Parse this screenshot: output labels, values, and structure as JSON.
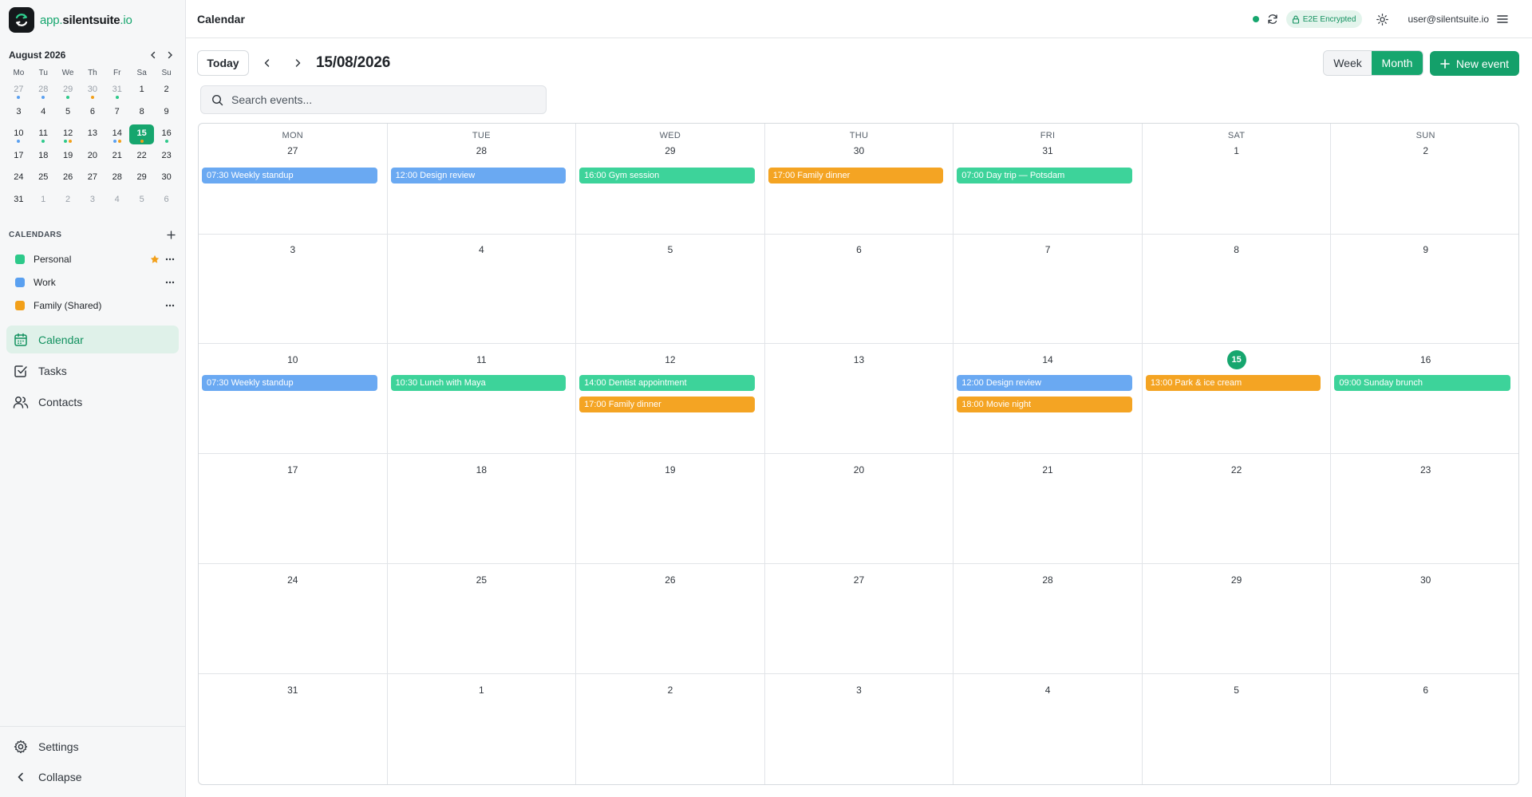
{
  "brand": {
    "app": "app.",
    "domain": "silentsuite",
    "tld": ".io"
  },
  "mini_calendar": {
    "title": "August 2026",
    "weekdays": [
      "Mo",
      "Tu",
      "We",
      "Th",
      "Fr",
      "Sa",
      "Su"
    ],
    "weeks": [
      [
        {
          "d": "27",
          "out": true,
          "dots": [
            "#5aa0f0"
          ]
        },
        {
          "d": "28",
          "out": true,
          "dots": [
            "#5aa0f0"
          ]
        },
        {
          "d": "29",
          "out": true,
          "dots": [
            "#2dc98a"
          ]
        },
        {
          "d": "30",
          "out": true,
          "dots": [
            "#f2a01a"
          ]
        },
        {
          "d": "31",
          "out": true,
          "dots": [
            "#2dc98a"
          ]
        },
        {
          "d": "1"
        },
        {
          "d": "2"
        }
      ],
      [
        {
          "d": "3"
        },
        {
          "d": "4"
        },
        {
          "d": "5"
        },
        {
          "d": "6"
        },
        {
          "d": "7"
        },
        {
          "d": "8"
        },
        {
          "d": "9"
        }
      ],
      [
        {
          "d": "10",
          "dots": [
            "#5aa0f0"
          ]
        },
        {
          "d": "11",
          "dots": [
            "#2dc98a"
          ]
        },
        {
          "d": "12",
          "dots": [
            "#2dc98a",
            "#f2a01a"
          ]
        },
        {
          "d": "13"
        },
        {
          "d": "14",
          "dots": [
            "#5aa0f0",
            "#f2a01a"
          ]
        },
        {
          "d": "15",
          "today": true,
          "dots": [
            "#f2a01a"
          ]
        },
        {
          "d": "16",
          "dots": [
            "#2dc98a"
          ]
        }
      ],
      [
        {
          "d": "17"
        },
        {
          "d": "18"
        },
        {
          "d": "19"
        },
        {
          "d": "20"
        },
        {
          "d": "21"
        },
        {
          "d": "22"
        },
        {
          "d": "23"
        }
      ],
      [
        {
          "d": "24"
        },
        {
          "d": "25"
        },
        {
          "d": "26"
        },
        {
          "d": "27"
        },
        {
          "d": "28"
        },
        {
          "d": "29"
        },
        {
          "d": "30"
        }
      ],
      [
        {
          "d": "31"
        },
        {
          "d": "1",
          "out": true
        },
        {
          "d": "2",
          "out": true
        },
        {
          "d": "3",
          "out": true
        },
        {
          "d": "4",
          "out": true
        },
        {
          "d": "5",
          "out": true
        },
        {
          "d": "6",
          "out": true
        }
      ]
    ]
  },
  "calendars": {
    "title": "CALENDARS",
    "items": [
      {
        "name": "Personal",
        "color": "#2dc98a",
        "default": true
      },
      {
        "name": "Work",
        "color": "#5aa0f0",
        "default": false
      },
      {
        "name": "Family (Shared)",
        "color": "#f2a01a",
        "default": false
      }
    ]
  },
  "nav": {
    "calendar": "Calendar",
    "tasks": "Tasks",
    "contacts": "Contacts",
    "settings": "Settings",
    "collapse": "Collapse"
  },
  "topbar": {
    "title": "Calendar",
    "encryption_badge": "E2E Encrypted",
    "user_email": "user@silentsuite.io"
  },
  "toolbar": {
    "today_label": "Today",
    "current_date": "15/08/2026",
    "week_label": "Week",
    "month_label": "Month",
    "new_event_label": "New event",
    "search_placeholder": "Search events..."
  },
  "colors": {
    "accent": "#16a66e",
    "work": "#5aa0f0",
    "personal": "#2dc98a",
    "family": "#f2a01a"
  },
  "month_view": {
    "weekdays": [
      "MON",
      "TUE",
      "WED",
      "THU",
      "FRI",
      "SAT",
      "SUN"
    ],
    "weeks": [
      [
        {
          "d": "27",
          "events": [
            {
              "label": "07:30 Weekly standup",
              "color": "#6aa9f2"
            }
          ]
        },
        {
          "d": "28",
          "events": [
            {
              "label": "12:00 Design review",
              "color": "#6aa9f2"
            }
          ]
        },
        {
          "d": "29",
          "events": [
            {
              "label": "16:00 Gym session",
              "color": "#3dd39a"
            }
          ]
        },
        {
          "d": "30",
          "events": [
            {
              "label": "17:00 Family dinner",
              "color": "#f4a423"
            }
          ]
        },
        {
          "d": "31",
          "events": [
            {
              "label": "07:00 Day trip — Potsdam",
              "color": "#3dd39a"
            }
          ]
        },
        {
          "d": "1",
          "events": []
        },
        {
          "d": "2",
          "events": []
        }
      ],
      [
        {
          "d": "3",
          "events": []
        },
        {
          "d": "4",
          "events": []
        },
        {
          "d": "5",
          "events": []
        },
        {
          "d": "6",
          "events": []
        },
        {
          "d": "7",
          "events": []
        },
        {
          "d": "8",
          "events": []
        },
        {
          "d": "9",
          "events": []
        }
      ],
      [
        {
          "d": "10",
          "events": [
            {
              "label": "07:30 Weekly standup",
              "color": "#6aa9f2"
            }
          ]
        },
        {
          "d": "11",
          "events": [
            {
              "label": "10:30 Lunch with Maya",
              "color": "#3dd39a"
            }
          ]
        },
        {
          "d": "12",
          "events": [
            {
              "label": "14:00 Dentist appointment",
              "color": "#3dd39a"
            },
            {
              "label": "17:00 Family dinner",
              "color": "#f4a423"
            }
          ]
        },
        {
          "d": "13",
          "events": []
        },
        {
          "d": "14",
          "events": [
            {
              "label": "12:00 Design review",
              "color": "#6aa9f2"
            },
            {
              "label": "18:00 Movie night",
              "color": "#f4a423"
            }
          ]
        },
        {
          "d": "15",
          "today": true,
          "events": [
            {
              "label": "13:00 Park & ice cream",
              "color": "#f4a423"
            }
          ]
        },
        {
          "d": "16",
          "events": [
            {
              "label": "09:00 Sunday brunch",
              "color": "#3dd39a"
            }
          ]
        }
      ],
      [
        {
          "d": "17",
          "events": []
        },
        {
          "d": "18",
          "events": []
        },
        {
          "d": "19",
          "events": []
        },
        {
          "d": "20",
          "events": []
        },
        {
          "d": "21",
          "events": []
        },
        {
          "d": "22",
          "events": []
        },
        {
          "d": "23",
          "events": []
        }
      ],
      [
        {
          "d": "24",
          "events": []
        },
        {
          "d": "25",
          "events": []
        },
        {
          "d": "26",
          "events": []
        },
        {
          "d": "27",
          "events": []
        },
        {
          "d": "28",
          "events": []
        },
        {
          "d": "29",
          "events": []
        },
        {
          "d": "30",
          "events": []
        }
      ],
      [
        {
          "d": "31",
          "events": []
        },
        {
          "d": "1",
          "events": []
        },
        {
          "d": "2",
          "events": []
        },
        {
          "d": "3",
          "events": []
        },
        {
          "d": "4",
          "events": []
        },
        {
          "d": "5",
          "events": []
        },
        {
          "d": "6",
          "events": []
        }
      ]
    ]
  }
}
